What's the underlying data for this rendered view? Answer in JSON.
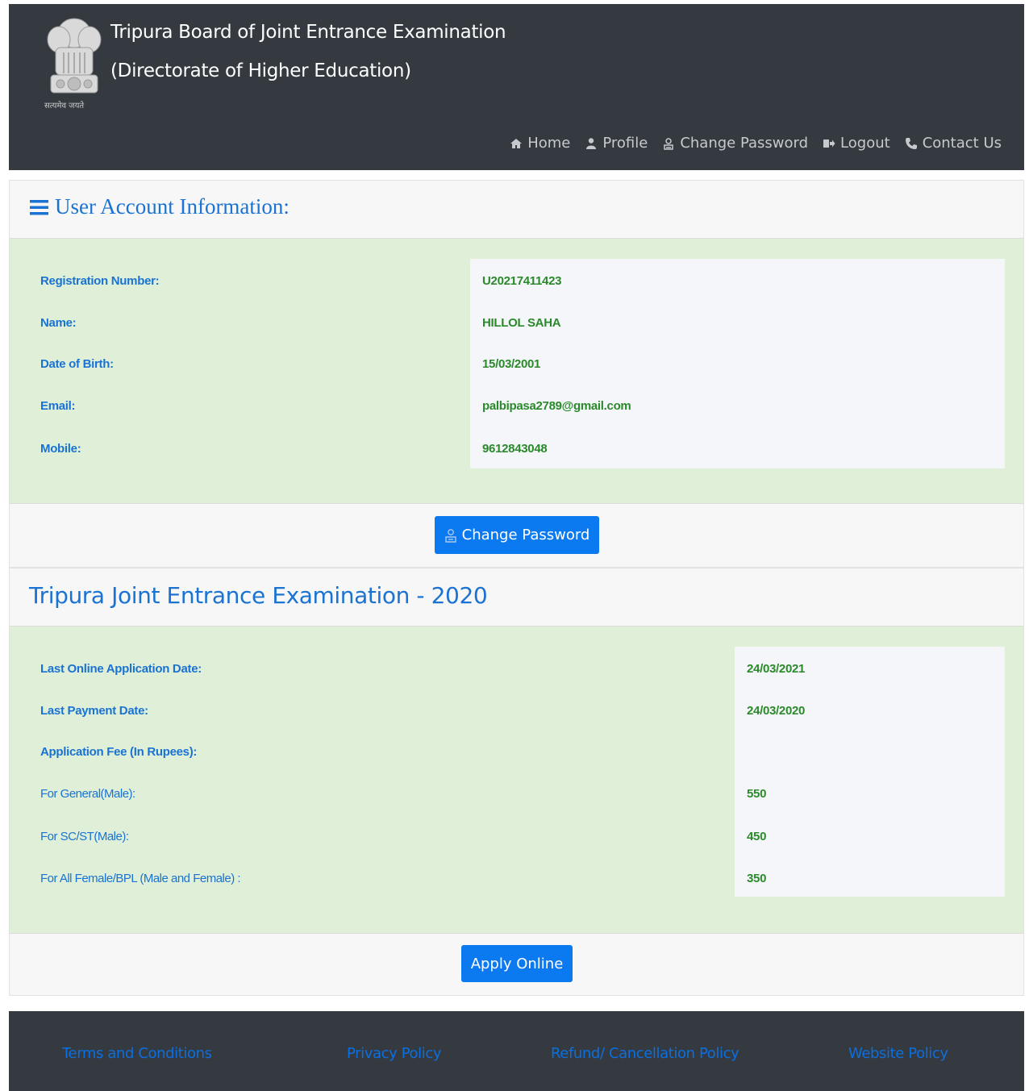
{
  "header": {
    "title_line1": "Tripura Board of Joint Entrance Examination",
    "title_line2": "(Directorate of Higher Education)",
    "emblem_caption": "सत्यमेव जयते",
    "nav": [
      {
        "label": "Home",
        "icon": "home-icon"
      },
      {
        "label": "Profile",
        "icon": "user-icon"
      },
      {
        "label": "Change Password",
        "icon": "lock-user-icon"
      },
      {
        "label": "Logout",
        "icon": "logout-icon"
      },
      {
        "label": "Contact Us",
        "icon": "phone-icon"
      }
    ]
  },
  "account": {
    "heading": "User Account Information:",
    "fields": [
      {
        "label": "Registration Number:",
        "value": "U20217411423"
      },
      {
        "label": "Name:",
        "value": "HILLOL SAHA"
      },
      {
        "label": "Date of Birth:",
        "value": "15/03/2001"
      },
      {
        "label": "Email:",
        "value": "palbipasa2789@gmail.com"
      },
      {
        "label": "Mobile:",
        "value": "9612843048"
      }
    ],
    "button_label": "Change Password"
  },
  "exam": {
    "heading": "Tripura Joint Entrance Examination - 2020",
    "fields": [
      {
        "label": "Last Online Application Date:",
        "value": "24/03/2021"
      },
      {
        "label": "Last Payment Date:",
        "value": "24/03/2020"
      },
      {
        "label": "Application Fee (In Rupees):",
        "value": ""
      },
      {
        "label": "For General(Male):",
        "value": "550"
      },
      {
        "label": "For SC/ST(Male):",
        "value": "450"
      },
      {
        "label": "For All Female/BPL (Male and Female) :",
        "value": "350"
      }
    ],
    "button_label": "Apply Online"
  },
  "footer": {
    "links": [
      "Terms and Conditions",
      "Privacy Policy",
      "Refund/ Cancellation Policy",
      "Website Policy"
    ]
  },
  "colors": {
    "header_bg": "#343a40",
    "accent_blue": "#1a73d2",
    "button_blue": "#0b79f0",
    "value_green": "#2a8a2a",
    "panel_green": "#e0efd8"
  }
}
